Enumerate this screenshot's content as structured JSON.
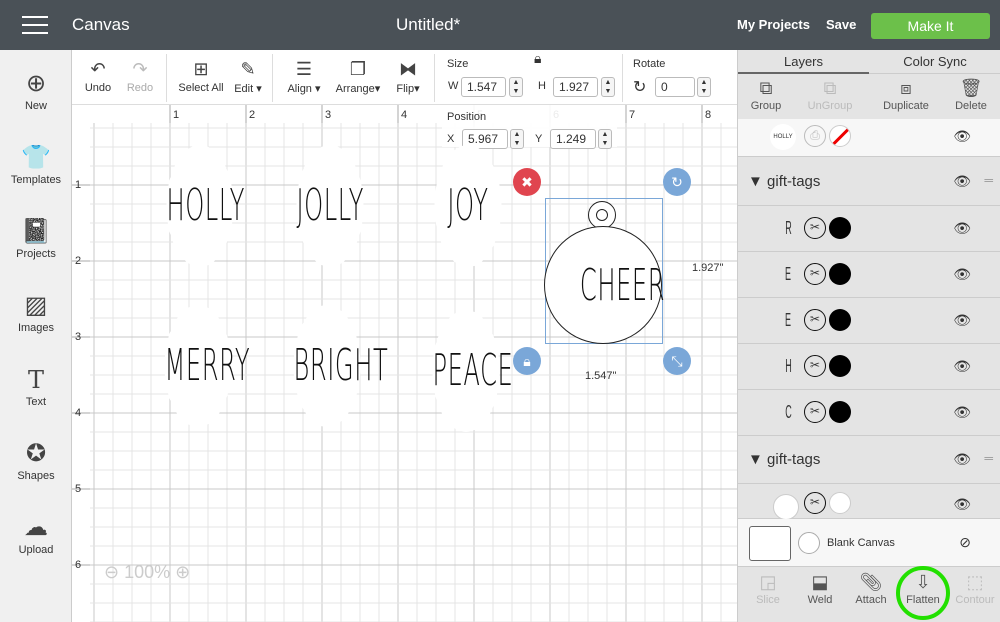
{
  "header": {
    "app": "Canvas",
    "title": "Untitled*",
    "my_projects": "My Projects",
    "save": "Save",
    "make_it": "Make It",
    "accent": "#6cc04a"
  },
  "sidebar": [
    {
      "label": "New",
      "icon": "plus-circle-icon"
    },
    {
      "label": "Templates",
      "icon": "tshirt-icon"
    },
    {
      "label": "Projects",
      "icon": "book-icon"
    },
    {
      "label": "Images",
      "icon": "image-icon"
    },
    {
      "label": "Text",
      "icon": "text-icon"
    },
    {
      "label": "Shapes",
      "icon": "shapes-icon"
    },
    {
      "label": "Upload",
      "icon": "upload-cloud-icon"
    }
  ],
  "toolbar": {
    "undo": "Undo",
    "redo": "Redo",
    "select_all": "Select All",
    "edit": "Edit",
    "align": "Align",
    "arrange": "Arrange",
    "flip": "Flip",
    "size": "Size",
    "w_label": "W",
    "w": "1.547",
    "h_label": "H",
    "h": "1.927",
    "rotate": "Rotate",
    "rotate_val": "0",
    "position": "Position",
    "x_label": "X",
    "x": "5.967",
    "y_label": "Y",
    "y": "1.249"
  },
  "ruler": {
    "x": [
      "1",
      "2",
      "3",
      "4",
      "5",
      "6",
      "7",
      "8"
    ],
    "y": [
      "1",
      "2",
      "3",
      "4",
      "5",
      "6"
    ]
  },
  "canvas": {
    "tags": [
      "HOLLY",
      "JOLLY",
      "JOY",
      "MERRY",
      "BRIGHT",
      "PEACE"
    ],
    "selected": "CHEER",
    "dim_h": "1.927\"",
    "dim_w": "1.547\"",
    "zoom": "100%"
  },
  "panel": {
    "tabs": [
      "Layers",
      "Color Sync"
    ],
    "actions": [
      "Group",
      "UnGroup",
      "Duplicate",
      "Delete"
    ],
    "top_item": "HOLLY",
    "group1": "gift-tags",
    "group1_items": [
      "R",
      "E",
      "E",
      "H",
      "C"
    ],
    "group2": "gift-tags",
    "blank": "Blank Canvas",
    "bottom": [
      "Slice",
      "Weld",
      "Attach",
      "Flatten",
      "Contour"
    ],
    "highlight": "#22e000"
  }
}
